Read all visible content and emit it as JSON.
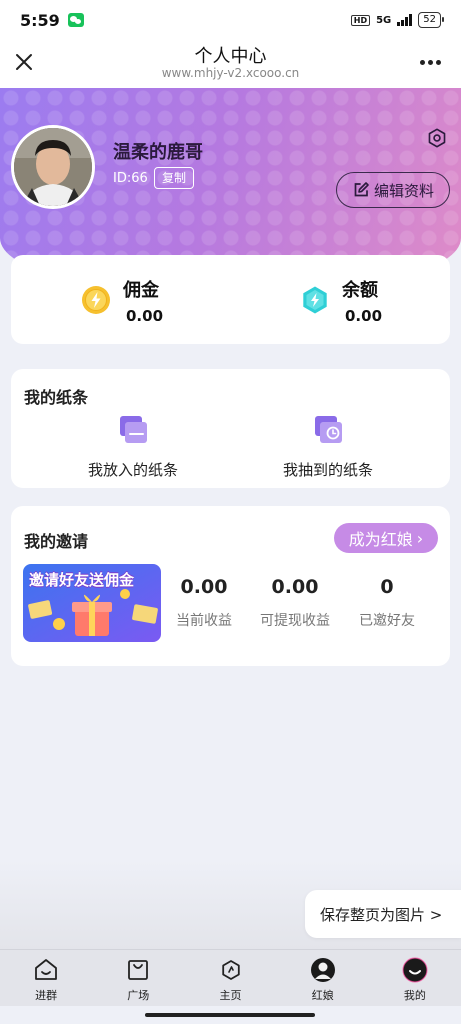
{
  "status_bar": {
    "time": "5:59",
    "hd": "HD",
    "network": "5G",
    "battery": "52"
  },
  "nav": {
    "title": "个人中心",
    "url": "www.mhjy-v2.xcooo.cn"
  },
  "profile": {
    "username": "温柔的鹿哥",
    "id_text": "ID:66",
    "copy_label": "复制",
    "edit_label": "编辑资料"
  },
  "wallet": {
    "commission": {
      "label": "佣金",
      "value": "0.00",
      "icon": "lightning-coin-icon",
      "color": "#f6c02e"
    },
    "balance": {
      "label": "余额",
      "value": "0.00",
      "icon": "diamond-icon",
      "color": "#2fcfd6"
    }
  },
  "notes": {
    "title": "我的纸条",
    "items": [
      {
        "label": "我放入的纸条",
        "icon": "put-note-icon"
      },
      {
        "label": "我抽到的纸条",
        "icon": "drawn-note-icon"
      }
    ]
  },
  "invite": {
    "title": "我的邀请",
    "matchmaker_label": "成为红娘",
    "banner_text": "邀请好友送佣金",
    "stats": [
      {
        "value": "0.00",
        "label": "当前收益"
      },
      {
        "value": "0.00",
        "label": "可提现收益"
      },
      {
        "value": "0",
        "label": "已邀好友"
      }
    ]
  },
  "save_page_label": "保存整页为图片 >",
  "tabs": [
    {
      "label": "进群",
      "icon": "home-group-icon"
    },
    {
      "label": "广场",
      "icon": "square-bag-icon"
    },
    {
      "label": "主页",
      "icon": "hexagon-home-icon"
    },
    {
      "label": "红娘",
      "icon": "matchmaker-avatar-icon"
    },
    {
      "label": "我的",
      "icon": "my-profile-icon"
    }
  ],
  "colors": {
    "accent": "#c68be6",
    "header_start": "#9b7cf0",
    "header_end": "#e08cc7",
    "note_icon": "#8a6be8"
  }
}
